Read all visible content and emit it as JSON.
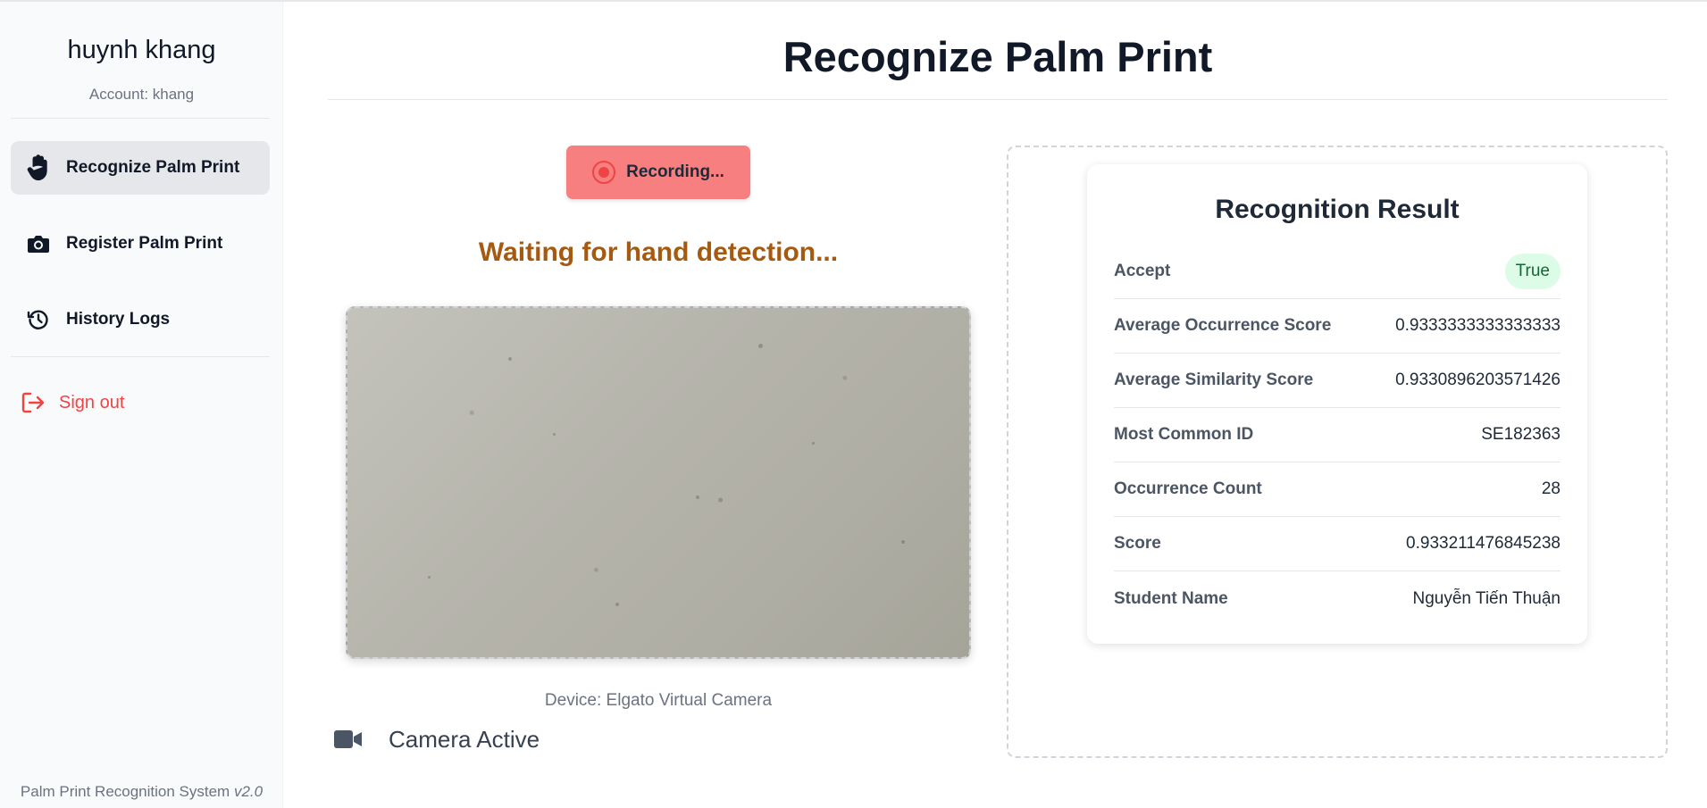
{
  "sidebar": {
    "user_name": "huynh khang",
    "account": "Account: khang",
    "items": [
      {
        "label": "Recognize Palm Print",
        "icon": "hand-icon",
        "active": true
      },
      {
        "label": "Register Palm Print",
        "icon": "camera-icon",
        "active": false
      },
      {
        "label": "History Logs",
        "icon": "history-icon",
        "active": false
      }
    ],
    "signout_label": "Sign out",
    "footer_text": "Palm Print Recognition System ",
    "footer_version": "v2.0"
  },
  "main": {
    "title": "Recognize Palm Print",
    "record_button_label": "Recording...",
    "status_message": "Waiting for hand detection...",
    "device_label": "Device: Elgato Virtual Camera",
    "camera_status": "Camera Active"
  },
  "result": {
    "title": "Recognition Result",
    "rows": [
      {
        "key": "Accept",
        "value": "True"
      },
      {
        "key": "Average Occurrence Score",
        "value": "0.9333333333333333"
      },
      {
        "key": "Average Similarity Score",
        "value": "0.9330896203571426"
      },
      {
        "key": "Most Common ID",
        "value": "SE182363"
      },
      {
        "key": "Occurrence Count",
        "value": "28"
      },
      {
        "key": "Score",
        "value": "0.933211476845238"
      },
      {
        "key": "Student Name",
        "value": "Nguyễn Tiến Thuận"
      }
    ]
  },
  "colors": {
    "accent_red": "#ef4444",
    "record_button": "#f87f7f",
    "waiting_text": "#a55a10",
    "accept_badge": "#dcfce7"
  }
}
